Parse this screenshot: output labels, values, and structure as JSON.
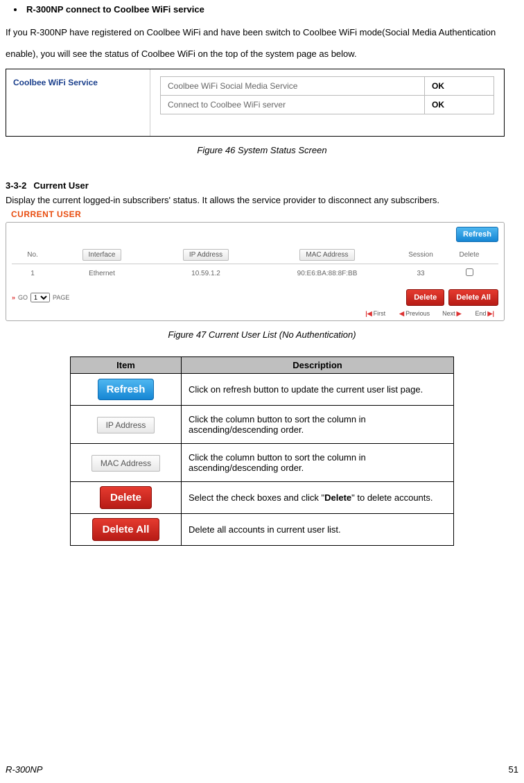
{
  "bullet_title": "R-300NP connect to Coolbee WiFi service",
  "intro_para": "If you R-300NP have registered on Coolbee WiFi and have been switch to Coolbee WiFi mode(Social Media Authentication enable), you will see the status of Coolbee WiFi on the top of the system page as below.",
  "status": {
    "left_label": "Coolbee WiFi Service",
    "rows": [
      {
        "label": "Coolbee WiFi Social Media Service",
        "value": "OK"
      },
      {
        "label": "Connect to Coolbee WiFi server",
        "value": "OK"
      }
    ]
  },
  "fig46": "Figure 46 System Status Screen",
  "sec": {
    "num": "3-3-2",
    "title": "Current User"
  },
  "sec_para": "Display the current logged-in subscribers' status. It allows the service provider to disconnect any subscribers.",
  "cu": {
    "title": "CURRENT USER",
    "refresh": "Refresh",
    "headers": {
      "no": "No.",
      "iface": "Interface",
      "ip": "IP Address",
      "mac": "MAC Address",
      "session": "Session",
      "del": "Delete"
    },
    "row": {
      "no": "1",
      "iface": "Ethernet",
      "ip": "10.59.1.2",
      "mac": "90:E6:BA:88:8F:BB",
      "session": "33"
    },
    "go": {
      "arrow": "»",
      "label": "GO",
      "page": "PAGE",
      "select": "1"
    },
    "del": "Delete",
    "delall": "Delete All",
    "pager": {
      "first": "First",
      "prev": "Previous",
      "next": "Next",
      "end": "End"
    }
  },
  "fig47": "Figure 47 Current User List (No Authentication)",
  "table": {
    "h1": "Item",
    "h2": "Description",
    "rows": [
      {
        "btn": "Refresh",
        "desc": "Click on refresh button to update the current user list page."
      },
      {
        "btn": "IP Address",
        "desc": "Click the column button to sort the column in ascending/descending order."
      },
      {
        "btn": "MAC Address",
        "desc": "Click the column button to sort the column in ascending/descending order."
      },
      {
        "btn": "Delete",
        "desc_pre": "Select the check boxes and click \"",
        "desc_bold": "Delete",
        "desc_post": "\"  to delete accounts."
      },
      {
        "btn": "Delete All",
        "desc": "Delete all accounts in current user list."
      }
    ]
  },
  "footer": {
    "model": "R-300NP",
    "page": "51"
  }
}
